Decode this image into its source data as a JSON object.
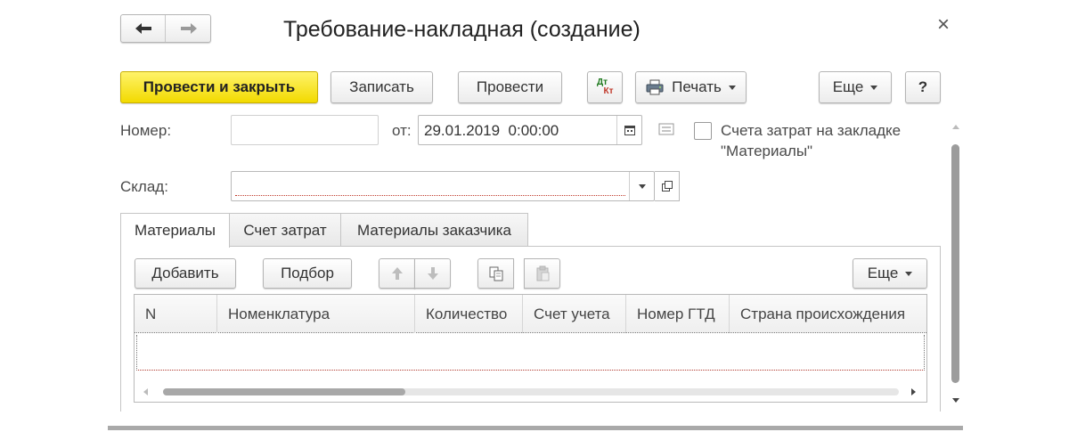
{
  "window": {
    "title": "Требование-накладная (создание)",
    "close_glyph": "×"
  },
  "toolbar": {
    "post_close_label": "Провести и закрыть",
    "save_label": "Записать",
    "post_label": "Провести",
    "dtkt_top": "Дт",
    "dtkt_bottom": "Кт",
    "print_label": "Печать",
    "more_label": "Еще",
    "help_label": "?"
  },
  "form": {
    "number_label": "Номер:",
    "number_value": "",
    "date_label": "от:",
    "date_value": "29.01.2019  0:00:00",
    "cost_accounts_label_line1": "Счета затрат на закладке",
    "cost_accounts_label_line2": "\"Материалы\"",
    "cost_accounts_checked": false,
    "warehouse_label": "Склад:",
    "warehouse_value": ""
  },
  "tabs": [
    {
      "label": "Материалы",
      "active": true
    },
    {
      "label": "Счет затрат",
      "active": false
    },
    {
      "label": "Материалы заказчика",
      "active": false
    }
  ],
  "table_toolbar": {
    "add_label": "Добавить",
    "pick_label": "Подбор",
    "more_label": "Еще"
  },
  "table": {
    "columns": [
      "N",
      "Номенклатура",
      "Количество",
      "Счет учета",
      "Номер ГТД",
      "Страна происхождения"
    ],
    "rows": []
  },
  "colors": {
    "primary_button": "#f5e000",
    "required_underline": "#c0392b"
  },
  "icons": {
    "back": "back-arrow-icon",
    "forward": "forward-arrow-icon",
    "printer": "printer-icon",
    "calendar": "calendar-icon",
    "comment": "comment-lines-icon",
    "open": "open-form-icon",
    "move_up": "arrow-up-icon",
    "move_down": "arrow-down-icon",
    "copy": "copy-icon",
    "paste": "paste-icon"
  }
}
